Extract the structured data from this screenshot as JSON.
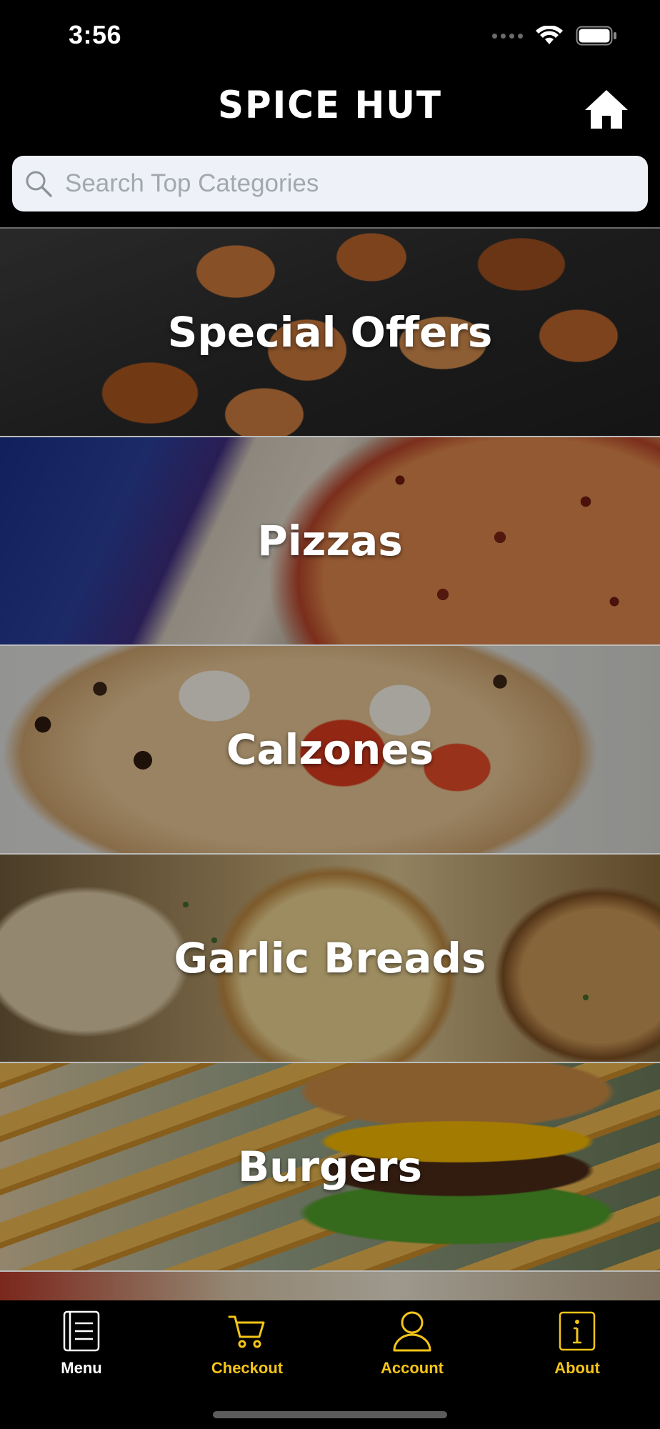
{
  "status_bar": {
    "time": "3:56"
  },
  "header": {
    "title": "SPICE HUT",
    "home_icon": "home-icon"
  },
  "search": {
    "placeholder": "Search Top Categories",
    "value": ""
  },
  "categories": [
    {
      "label": "Special Offers"
    },
    {
      "label": "Pizzas"
    },
    {
      "label": "Calzones"
    },
    {
      "label": "Garlic Breads"
    },
    {
      "label": "Burgers"
    }
  ],
  "tab_bar": {
    "items": [
      {
        "label": "Menu",
        "icon": "menu-icon",
        "color": "#ffffff"
      },
      {
        "label": "Checkout",
        "icon": "cart-icon",
        "color": "#f5c518"
      },
      {
        "label": "Account",
        "icon": "user-icon",
        "color": "#f5c518"
      },
      {
        "label": "About",
        "icon": "info-icon",
        "color": "#f5c518"
      }
    ]
  },
  "colors": {
    "background": "#000000",
    "accent": "#f5c518",
    "search_bg": "#eef1f7"
  }
}
